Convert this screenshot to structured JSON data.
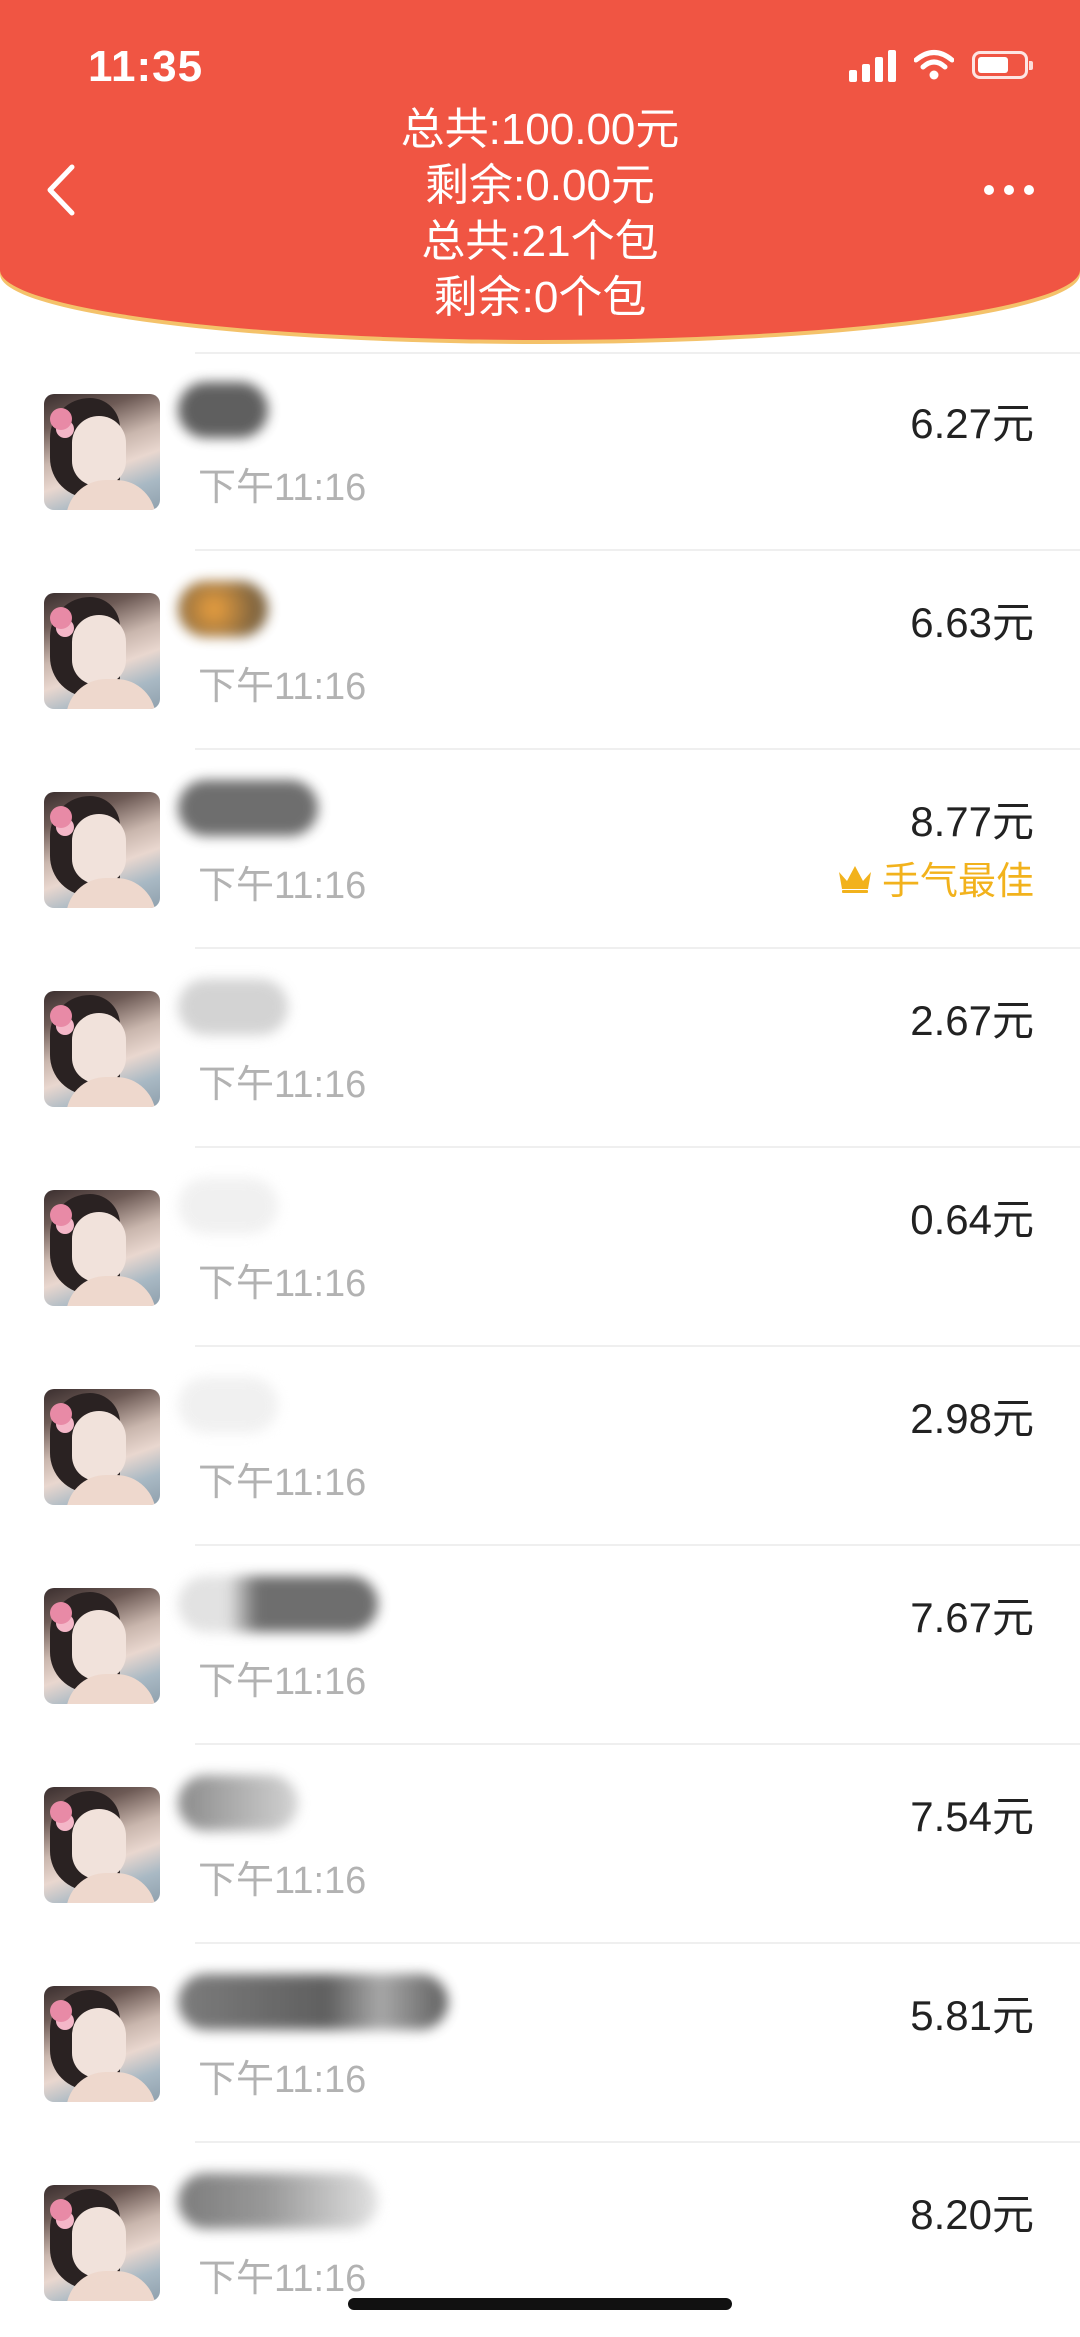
{
  "status_bar": {
    "time": "11:35",
    "icons": [
      "cellular-signal-icon",
      "wifi-icon",
      "battery-icon"
    ]
  },
  "header": {
    "background_color": "#f05543",
    "accent_color": "#f4c26a",
    "back_icon": "chevron-left-icon",
    "more_icon": "more-dots-icon",
    "summary": {
      "total_amount": "总共:100.00元",
      "remaining_amount": "剩余:0.00元",
      "total_packets": "总共:21个包",
      "remaining_packets": "剩余:0个包"
    }
  },
  "records": [
    {
      "time": "下午11:16",
      "amount": "6.27元"
    },
    {
      "time": "下午11:16",
      "amount": "6.63元"
    },
    {
      "time": "下午11:16",
      "amount": "8.77元",
      "badge": "手气最佳",
      "badge_icon": "crown-icon",
      "badge_color": "#f2b21c"
    },
    {
      "time": "下午11:16",
      "amount": "2.67元"
    },
    {
      "time": "下午11:16",
      "amount": "0.64元"
    },
    {
      "time": "下午11:16",
      "amount": "2.98元"
    },
    {
      "time": "下午11:16",
      "amount": "7.67元"
    },
    {
      "time": "下午11:16",
      "amount": "7.54元"
    },
    {
      "time": "下午11:16",
      "amount": "5.81元"
    },
    {
      "time": "下午11:16",
      "amount": "8.20元"
    }
  ]
}
